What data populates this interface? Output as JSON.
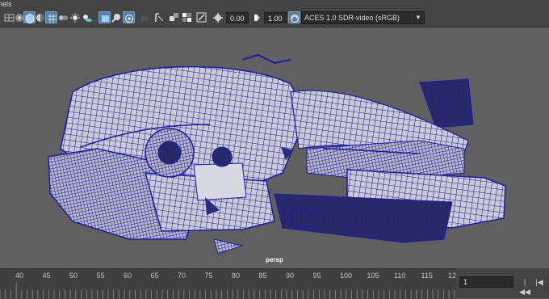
{
  "menu": {
    "panels_label": "nels"
  },
  "toolbar": {
    "icons": [
      "wireframe-shaded-icon",
      "xray-icon",
      "cube-shaded-icon",
      "textured-icon",
      "grid-icon",
      "camera-icon",
      "lights-icon",
      "shadows-icon",
      "gate-icon",
      "film-gate-icon",
      "resolution-gate-icon",
      "isolate-select-icon",
      "layout-icon",
      "frame-all-icon",
      "gamma-icon",
      "exposure-icon",
      "color-mgmt-icon"
    ],
    "exposure_value": "0.00",
    "gamma_value": "1.00",
    "color_space": "ACES 1.0 SDR-video (sRGB)"
  },
  "viewport": {
    "camera": "persp",
    "colors": {
      "wire": "#1c1ca0",
      "surface": "#c8c8d2",
      "background": "#606060"
    }
  },
  "timeline": {
    "labels": [
      "40",
      "45",
      "50",
      "55",
      "60",
      "65",
      "70",
      "75",
      "80",
      "85",
      "90",
      "95",
      "100",
      "105",
      "110",
      "115",
      "12"
    ],
    "current_frame": "1"
  }
}
